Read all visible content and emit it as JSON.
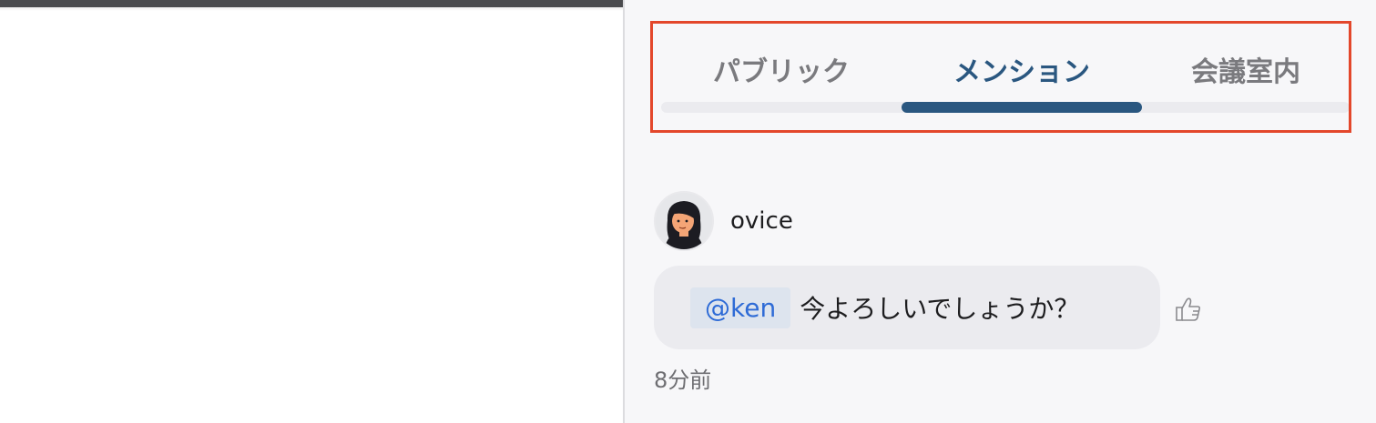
{
  "tabs": [
    {
      "label": "パブリック",
      "active": false
    },
    {
      "label": "メンション",
      "active": true
    },
    {
      "label": "会議室内",
      "active": false
    }
  ],
  "message": {
    "author": "ovice",
    "avatar": "woman-avatar-icon",
    "mention": "@ken",
    "text": "今よろしいでしょうか？",
    "time": "8分前",
    "reaction_icon": "thumbs-up-icon"
  },
  "colors": {
    "accent": "#2a5780",
    "highlight_box": "#e3472b",
    "mention_text": "#2e6bd6"
  }
}
